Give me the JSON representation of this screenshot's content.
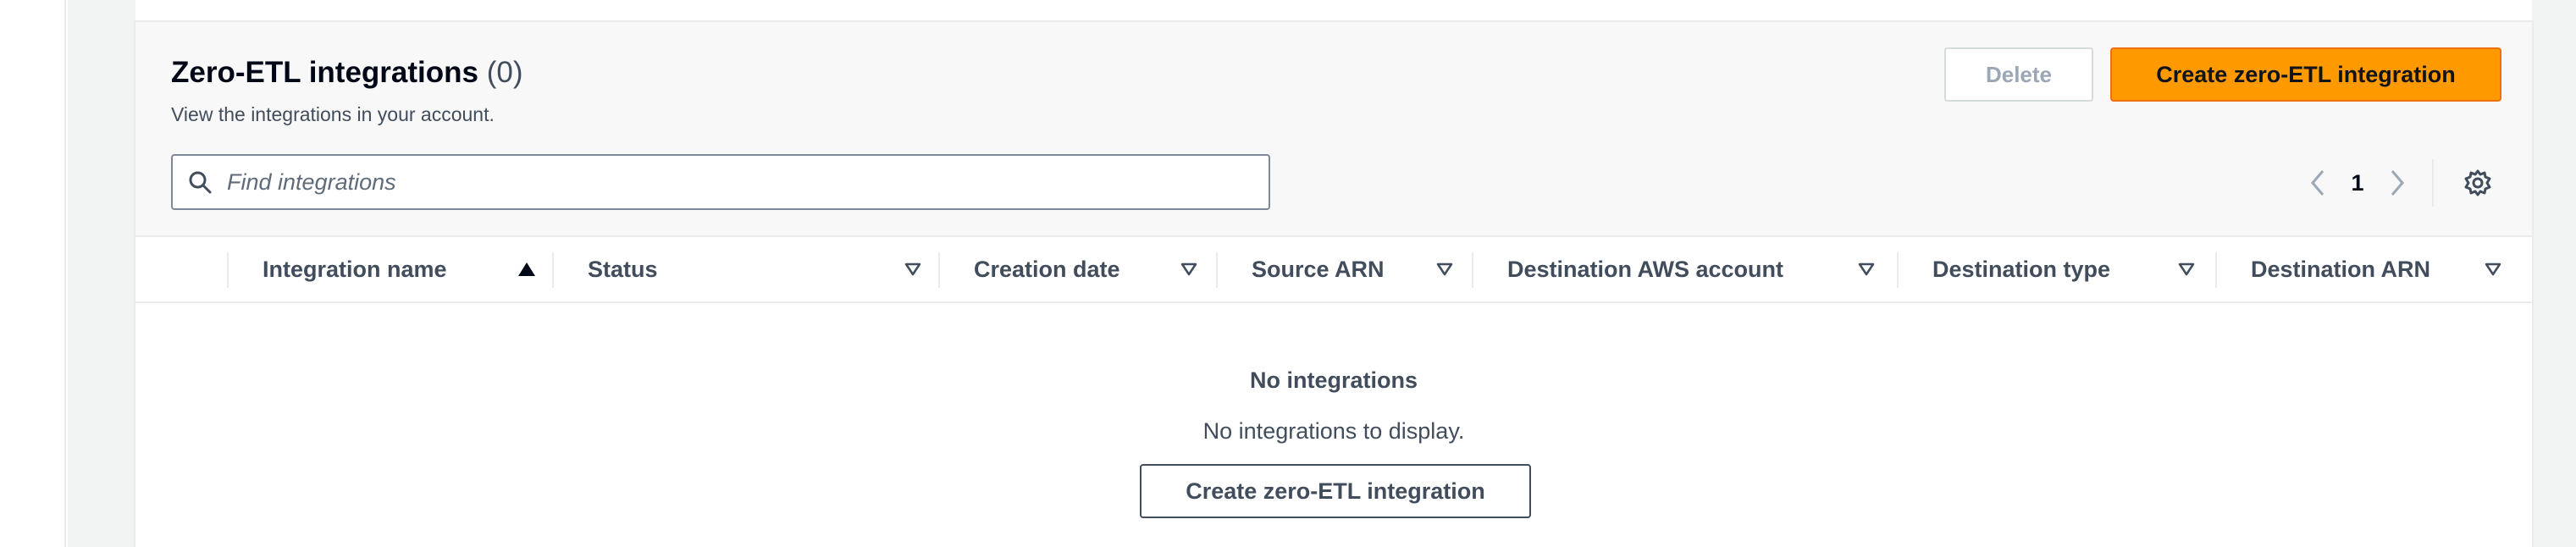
{
  "page": {
    "title": "Zero-ETL integrations",
    "count": "(0)",
    "subtitle": "View the integrations in your account."
  },
  "actions": {
    "delete_label": "Delete",
    "create_label": "Create zero-ETL integration"
  },
  "search": {
    "placeholder": "Find integrations",
    "value": ""
  },
  "pagination": {
    "current_page": "1"
  },
  "table": {
    "columns": [
      {
        "label": "Integration name",
        "sort": "ascending"
      },
      {
        "label": "Status",
        "sort": "none"
      },
      {
        "label": "Creation date",
        "sort": "none"
      },
      {
        "label": "Source ARN",
        "sort": "none"
      },
      {
        "label": "Destination AWS account",
        "sort": "none"
      },
      {
        "label": "Destination type",
        "sort": "none"
      },
      {
        "label": "Destination ARN",
        "sort": "none"
      }
    ],
    "rows": []
  },
  "empty_state": {
    "title": "No integrations",
    "description": "No integrations to display.",
    "button_label": "Create zero-ETL integration"
  },
  "colors": {
    "primary": "#ff9900",
    "text": "#0f141a",
    "muted": "#414d5c",
    "border": "#e9ebed"
  },
  "icons": [
    "search-icon",
    "chevron-left-icon",
    "chevron-right-icon",
    "settings-icon",
    "sort-ascending-icon",
    "sort-icon"
  ]
}
